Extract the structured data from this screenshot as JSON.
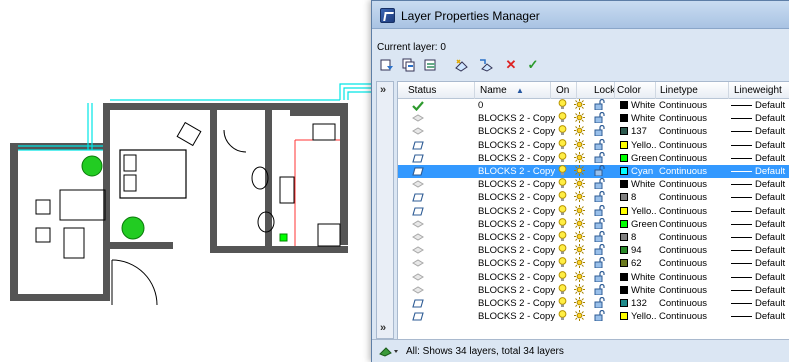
{
  "dialog": {
    "title": "Layer Properties Manager",
    "current_layer": "Current layer: 0",
    "status_text": "All: Shows 34 layers, total 34 layers"
  },
  "toolbar": {
    "icons": [
      "new-property-filter-icon",
      "new-group-filter-icon",
      "layer-states-icon",
      "new-layer-icon",
      "new-layer-vp-frozen-icon",
      "delete-layer-icon",
      "set-current-icon"
    ]
  },
  "columns": {
    "status": "Status",
    "name": "Name",
    "sort": "▲",
    "on": "On",
    "lock": "Lock",
    "color": "Color",
    "linetype": "Linetype",
    "lineweight": "Lineweight"
  },
  "rows": [
    {
      "status": "current",
      "name": "0",
      "color_name": "White",
      "swatch": "#000000",
      "linetype": "Continuous",
      "lineweight": "Default"
    },
    {
      "status": "used",
      "name": "BLOCKS 2 - Copy",
      "color_name": "White",
      "swatch": "#000000",
      "linetype": "Continuous",
      "lineweight": "Default"
    },
    {
      "status": "used",
      "name": "BLOCKS 2 - Copy",
      "color_name": "137",
      "swatch": "#2d5a4f",
      "linetype": "Continuous",
      "lineweight": "Default"
    },
    {
      "status": "empty",
      "name": "BLOCKS 2 - Copy",
      "color_name": "Yello..",
      "swatch": "#ffff00",
      "linetype": "Continuous",
      "lineweight": "Default"
    },
    {
      "status": "empty",
      "name": "BLOCKS 2 - Copy",
      "color_name": "Green",
      "swatch": "#00ff00",
      "linetype": "Continuous",
      "lineweight": "Default"
    },
    {
      "status": "empty",
      "name": "BLOCKS 2 - Copy",
      "color_name": "Cyan",
      "swatch": "#00ffff",
      "linetype": "Continuous",
      "lineweight": "Default",
      "selected": true
    },
    {
      "status": "used",
      "name": "BLOCKS 2 - Copy",
      "color_name": "White",
      "swatch": "#000000",
      "linetype": "Continuous",
      "lineweight": "Default"
    },
    {
      "status": "empty",
      "name": "BLOCKS 2 - Copy",
      "color_name": "8",
      "swatch": "#808080",
      "linetype": "Continuous",
      "lineweight": "Default"
    },
    {
      "status": "empty",
      "name": "BLOCKS 2 - Copy",
      "color_name": "Yello..",
      "swatch": "#ffff00",
      "linetype": "Continuous",
      "lineweight": "Default"
    },
    {
      "status": "used",
      "name": "BLOCKS 2 - Copy",
      "color_name": "Green",
      "swatch": "#00ff00",
      "linetype": "Continuous",
      "lineweight": "Default"
    },
    {
      "status": "used",
      "name": "BLOCKS 2 - Copy",
      "color_name": "8",
      "swatch": "#808080",
      "linetype": "Continuous",
      "lineweight": "Default"
    },
    {
      "status": "used",
      "name": "BLOCKS 2 - Copy",
      "color_name": "94",
      "swatch": "#2a8a2a",
      "linetype": "Continuous",
      "lineweight": "Default"
    },
    {
      "status": "used",
      "name": "BLOCKS 2 - Copy",
      "color_name": "62",
      "swatch": "#6b7a1e",
      "linetype": "Continuous",
      "lineweight": "Default"
    },
    {
      "status": "used",
      "name": "BLOCKS 2 - Copy",
      "color_name": "White",
      "swatch": "#000000",
      "linetype": "Continuous",
      "lineweight": "Default"
    },
    {
      "status": "used",
      "name": "BLOCKS 2 - Copy",
      "color_name": "White",
      "swatch": "#000000",
      "linetype": "Continuous",
      "lineweight": "Default"
    },
    {
      "status": "empty",
      "name": "BLOCKS 2 - Copy",
      "color_name": "132",
      "swatch": "#1f8a8a",
      "linetype": "Continuous",
      "lineweight": "Default"
    },
    {
      "status": "empty",
      "name": "BLOCKS 2 - Copy",
      "color_name": "Yello..",
      "swatch": "#ffff00",
      "linetype": "Continuous",
      "lineweight": "Default"
    }
  ],
  "colors": {
    "selection": "#3399ff",
    "dialog_bg": "#dbe6f3",
    "wall": "#505050",
    "cyan_layer": "#00ffff",
    "green_layer": "#00cc00",
    "red_layer": "#ff0000"
  }
}
